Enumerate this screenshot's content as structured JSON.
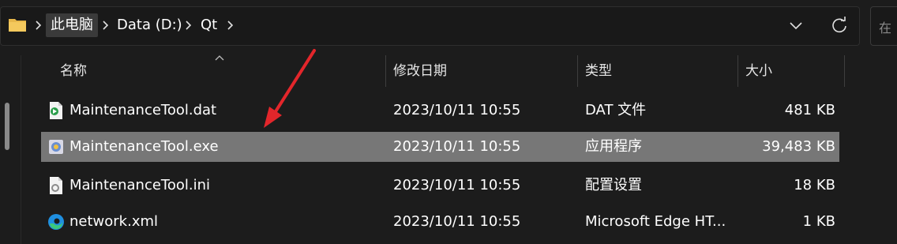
{
  "breadcrumb": {
    "items": [
      "此电脑",
      "Data (D:)",
      "Qt"
    ]
  },
  "search": {
    "placeholder": "在"
  },
  "columns": {
    "name": "名称",
    "modified": "修改日期",
    "type": "类型",
    "size": "大小"
  },
  "files": [
    {
      "name": "MaintenanceTool.dat",
      "modified": "2023/10/11 10:55",
      "type": "DAT 文件",
      "size": "481 KB",
      "icon": "dat-file-icon"
    },
    {
      "name": "MaintenanceTool.exe",
      "modified": "2023/10/11 10:55",
      "type": "应用程序",
      "size": "39,483 KB",
      "icon": "exe-file-icon",
      "selected": true
    },
    {
      "name": "MaintenanceTool.ini",
      "modified": "2023/10/11 10:55",
      "type": "配置设置",
      "size": "18 KB",
      "icon": "ini-file-icon"
    },
    {
      "name": "network.xml",
      "modified": "2023/10/11 10:55",
      "type": "Microsoft Edge HT...",
      "size": "1 KB",
      "icon": "edge-file-icon"
    }
  ],
  "colors": {
    "background": "#1c1c1c",
    "selection": "#777777",
    "annotation_arrow": "#e3262b",
    "folder": "#e8b84a"
  }
}
